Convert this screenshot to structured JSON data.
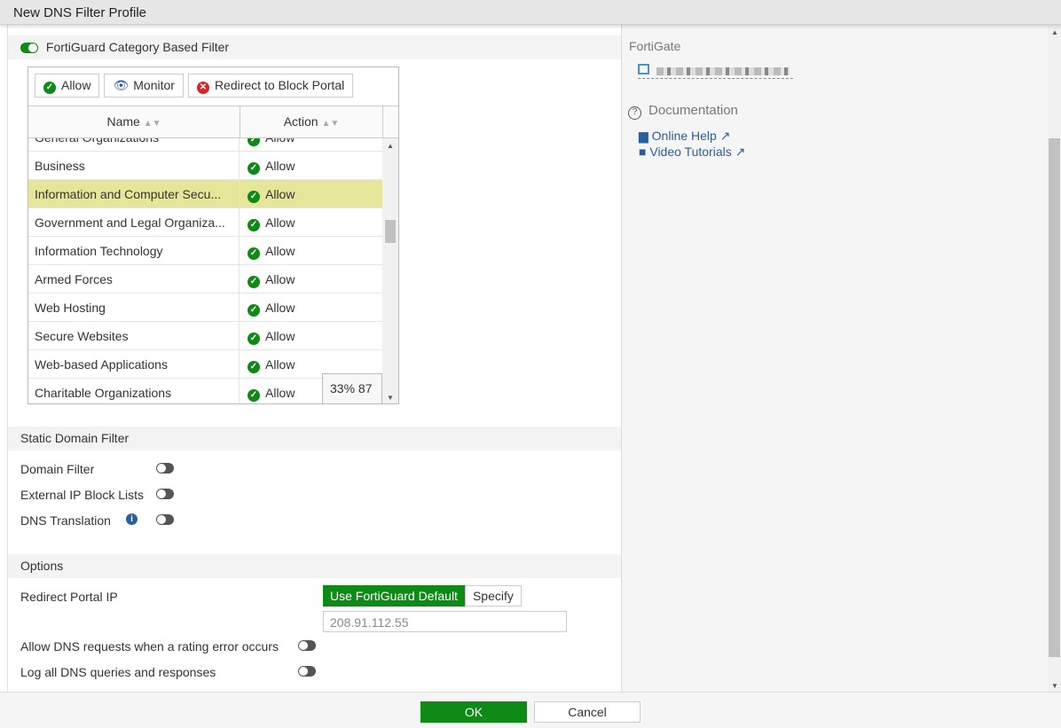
{
  "window": {
    "title": "New DNS Filter Profile"
  },
  "fortiguard": {
    "title": "FortiGuard Category Based Filter",
    "enabled": true,
    "toolbar": {
      "allow": "Allow",
      "monitor": "Monitor",
      "redirect": "Redirect to Block Portal"
    },
    "columns": {
      "name": "Name",
      "action": "Action"
    },
    "rows": [
      {
        "name": "General Organizations",
        "action": "Allow"
      },
      {
        "name": "Business",
        "action": "Allow"
      },
      {
        "name": "Information and Computer Secu...",
        "action": "Allow",
        "selected": true
      },
      {
        "name": "Government and Legal Organiza...",
        "action": "Allow"
      },
      {
        "name": "Information Technology",
        "action": "Allow"
      },
      {
        "name": "Armed Forces",
        "action": "Allow"
      },
      {
        "name": "Web Hosting",
        "action": "Allow"
      },
      {
        "name": "Secure Websites",
        "action": "Allow"
      },
      {
        "name": "Web-based Applications",
        "action": "Allow"
      },
      {
        "name": "Charitable Organizations",
        "action": "Allow"
      }
    ],
    "scroll_badge": "33% 87"
  },
  "static": {
    "title": "Static Domain Filter",
    "domain_filter": "Domain Filter",
    "external_ip": "External IP Block Lists",
    "dns_translation": "DNS Translation"
  },
  "options": {
    "title": "Options",
    "redirect_ip_label": "Redirect Portal IP",
    "use_default": "Use FortiGuard Default",
    "specify": "Specify",
    "ip_value": "208.91.112.55",
    "allow_dns": "Allow DNS requests when a rating error occurs",
    "log_all": "Log all DNS queries and responses"
  },
  "side": {
    "fortigate": "FortiGate",
    "documentation": "Documentation",
    "online_help": "Online Help",
    "video_tutorials": "Video Tutorials"
  },
  "footer": {
    "ok": "OK",
    "cancel": "Cancel"
  }
}
